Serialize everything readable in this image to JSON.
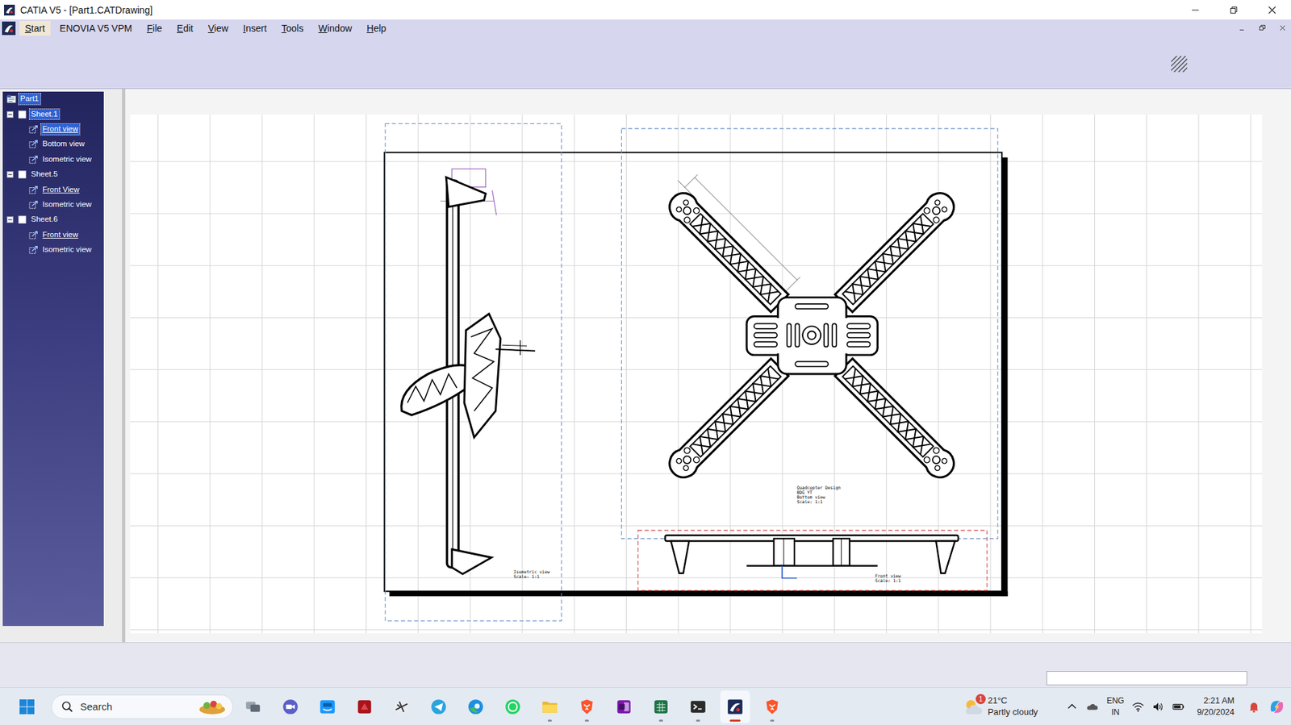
{
  "window": {
    "title": "CATIA V5 - [Part1.CATDrawing]"
  },
  "menu": [
    {
      "label": "Start",
      "selected": true,
      "mnemonic": true
    },
    {
      "label": "ENOVIA V5 VPM",
      "selected": false,
      "mnemonic": false
    },
    {
      "label": "File",
      "selected": false,
      "mnemonic": true
    },
    {
      "label": "Edit",
      "selected": false,
      "mnemonic": true
    },
    {
      "label": "View",
      "selected": false,
      "mnemonic": true
    },
    {
      "label": "Insert",
      "selected": false,
      "mnemonic": true
    },
    {
      "label": "Tools",
      "selected": false,
      "mnemonic": true
    },
    {
      "label": "Window",
      "selected": false,
      "mnemonic": true
    },
    {
      "label": "Help",
      "selected": false,
      "mnemonic": true
    }
  ],
  "tree": [
    {
      "label": "Part1",
      "kind": "part",
      "level": 0,
      "selected": true,
      "active": false
    },
    {
      "label": "Sheet.1",
      "kind": "sheet",
      "level": 1,
      "selected": true,
      "active": false,
      "expanded": true
    },
    {
      "label": "Front view",
      "kind": "view",
      "level": 2,
      "selected": true,
      "active": true
    },
    {
      "label": "Bottom view",
      "kind": "view",
      "level": 2,
      "selected": false,
      "active": false
    },
    {
      "label": "Isometric view",
      "kind": "view",
      "level": 2,
      "selected": false,
      "active": false
    },
    {
      "label": "Sheet.5",
      "kind": "sheet",
      "level": 1,
      "selected": false,
      "active": false,
      "expanded": true
    },
    {
      "label": "Front View",
      "kind": "view",
      "level": 2,
      "selected": false,
      "active": true
    },
    {
      "label": "Isometric view",
      "kind": "view",
      "level": 2,
      "selected": false,
      "active": false
    },
    {
      "label": "Sheet.6",
      "kind": "sheet",
      "level": 1,
      "selected": false,
      "active": false,
      "expanded": true
    },
    {
      "label": "Front view",
      "kind": "view",
      "level": 2,
      "selected": false,
      "active": true
    },
    {
      "label": "Isometric view",
      "kind": "view",
      "level": 2,
      "selected": false,
      "active": false
    }
  ],
  "drawing": {
    "title_block": [
      "Quadcopter Design",
      "BDG YT",
      "Bottom view",
      "Scale: 1:1"
    ],
    "isometric_label": [
      "Isometric view",
      "Scale: 1:1"
    ],
    "front_label": [
      "Front view",
      "Scale: 1:1"
    ]
  },
  "taskbar": {
    "search": {
      "placeholder": "Search"
    },
    "apps": [
      {
        "kind": "taskview",
        "running": false,
        "active": false
      },
      {
        "kind": "meet",
        "running": false,
        "active": false
      },
      {
        "kind": "primevideo",
        "running": false,
        "active": false
      },
      {
        "kind": "red-app",
        "running": false,
        "active": false
      },
      {
        "kind": "aircraft",
        "running": false,
        "active": false
      },
      {
        "kind": "telegram",
        "running": false,
        "active": false
      },
      {
        "kind": "edge",
        "running": false,
        "active": false
      },
      {
        "kind": "whatsapp",
        "running": false,
        "active": false
      },
      {
        "kind": "explorer",
        "running": true,
        "active": false
      },
      {
        "kind": "brave",
        "running": true,
        "active": false
      },
      {
        "kind": "onenote",
        "running": false,
        "active": false
      },
      {
        "kind": "spreadsheet",
        "running": true,
        "active": false
      },
      {
        "kind": "terminal",
        "running": true,
        "active": false
      },
      {
        "kind": "catia",
        "running": true,
        "active": true
      },
      {
        "kind": "brave",
        "running": true,
        "active": false
      }
    ],
    "weather": {
      "temperature": "21°C",
      "condition": "Partly cloudy",
      "badge": "1"
    },
    "language": [
      "ENG",
      "IN"
    ],
    "time": "2:21 AM",
    "date": "9/20/2024"
  }
}
